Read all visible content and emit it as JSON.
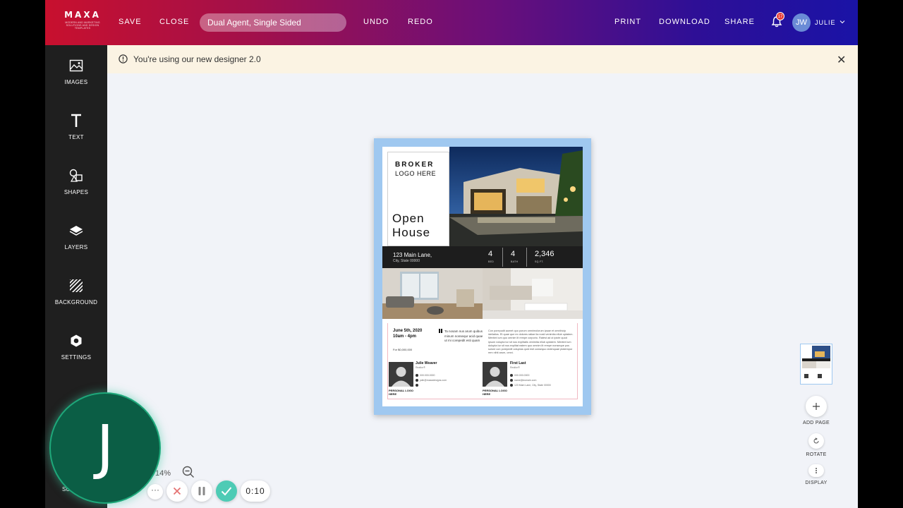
{
  "topbar": {
    "logo": "MAXA",
    "logo_tagline": "MODERN AND MARKETING SOLUTIONS AND DESIGN TEMPLATES",
    "save": "SAVE",
    "close": "CLOSE",
    "document_title": "Dual Agent, Single Sided",
    "undo": "UNDO",
    "redo": "REDO",
    "print": "PRINT",
    "download": "DOWNLOAD",
    "share": "SHARE",
    "notification_count": "17",
    "user_initials": "JW",
    "user_name": "JULIE"
  },
  "sidebar": {
    "items": [
      {
        "label": "IMAGES",
        "icon": "image-icon"
      },
      {
        "label": "TEXT",
        "icon": "text-icon"
      },
      {
        "label": "SHAPES",
        "icon": "shapes-icon"
      },
      {
        "label": "LAYERS",
        "icon": "layers-icon"
      },
      {
        "label": "BACKGROUND",
        "icon": "background-icon"
      },
      {
        "label": "SETTINGS",
        "icon": "settings-icon"
      }
    ],
    "partial_label": "SU"
  },
  "notice": {
    "text": "You're using our new designer 2.0",
    "close": "✕"
  },
  "flyer": {
    "broker_line1": "BROKER",
    "broker_line2": "LOGO HERE",
    "headline_line1": "Open",
    "headline_line2": "House",
    "address_line1": "123 Main Lane,",
    "address_line2": "City, State 00000",
    "beds": "4",
    "beds_label": "BED",
    "baths": "4",
    "baths_label": "BATH",
    "sqft": "2,346",
    "sqft_label": "SQ.FT.",
    "date_line1": "June 5th, 2020",
    "date_line2": "10am - 4pm",
    "price": "For $0,000,000",
    "quote": "Ta nosam nus arum quibus minum nonsequr acid quae ut mi corepedit esti quam",
    "description": "Con porepudit aumet quo porum omnimolorum ipsae et omnihicip ideliatios. Et quae que ex dolores ratiae lia nosti venimita ellub uptatem. Mentint lum quo omnim lit rempe corporio. Ratest ad ut ipicte quod ipsum volupta tur sit nus explitatis venimita ellub uptatem. Mentint lum dolupta tur sit nus explitat eatem quo omnim lit rempe nonseque pos solore con porepedit voluptas quid esti consequo dolenquae ptatempor rem nihit arum, omni.",
    "agents": [
      {
        "name": "Julie Weaver",
        "title": "Realtor®",
        "phone": "000.000.0000",
        "email": "julie@maxadesigns.com",
        "address": "",
        "personal_logo": "PERSONAL LOGO HERE"
      },
      {
        "name": "First Last",
        "title": "Realtor®",
        "phone": "000.000.0000",
        "email": "name@domain.com",
        "address": "123 Main Lane, City, State 00000",
        "personal_logo": "PERSONAL LOGO HERE"
      }
    ]
  },
  "right_panel": {
    "add_page": "ADD PAGE",
    "rotate": "ROTATE",
    "display": "DISPLAY"
  },
  "zoom": {
    "percent": "14%"
  },
  "recorder": {
    "initial": "J",
    "timer": "0:10",
    "more": "···"
  },
  "colors": {
    "accent_frame": "#9fc8f0",
    "topbar_start": "#c8102e",
    "topbar_end": "#1a13a6",
    "recorder_avatar": "#0b5e45",
    "confirm": "#4ecbb5",
    "cancel": "#e57373"
  }
}
